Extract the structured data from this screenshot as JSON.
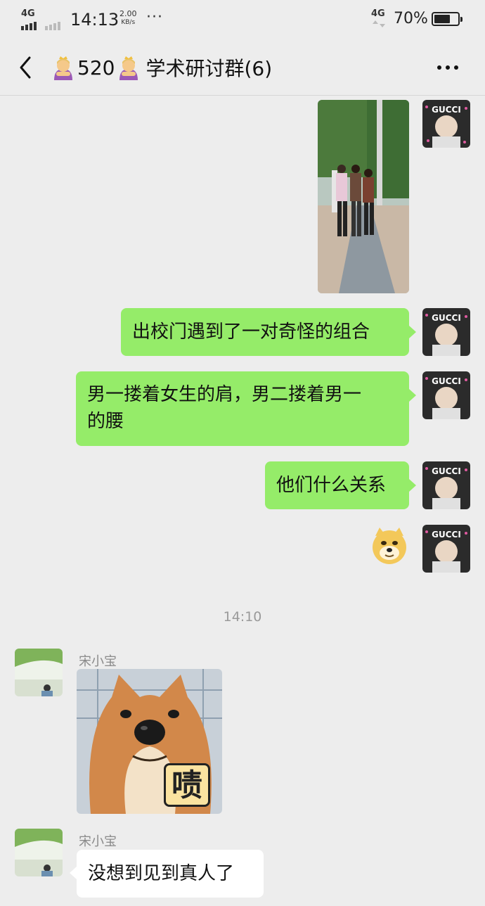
{
  "status_bar": {
    "net_left": "4G",
    "time": "14:13",
    "speed_value": "2.00",
    "speed_unit": "KB/s",
    "more_dots": "···",
    "net_right": "4G",
    "battery_percent": "70%",
    "battery_level": 0.7
  },
  "nav": {
    "back_icon": "chevron-left-icon",
    "title_number": "520",
    "title_text": "学术研讨群(6)",
    "title_emoji": "person-bowing-emoji",
    "more_icon": "more-dots-icon"
  },
  "messages": {
    "m1": {
      "type": "image",
      "icon": "street-photo"
    },
    "m2": {
      "text": "出校门遇到了一对奇怪的组合"
    },
    "m3": {
      "line1": "男一搂着女生的肩，男二搂着男一",
      "line2": "的腰"
    },
    "m4": {
      "text": "他们什么关系"
    },
    "m5": {
      "type": "sticker",
      "icon": "doge-emoji"
    },
    "timestamp": "14:10",
    "m6": {
      "sender": "宋小宝",
      "type": "sticker",
      "sticker_text": "啧",
      "icon": "shiba-dog-sticker"
    },
    "m7": {
      "sender": "宋小宝",
      "text": "没想到见到真人了"
    }
  },
  "colors": {
    "bubble_me": "#95ec69",
    "bubble_other": "#ffffff",
    "background": "#ededed"
  }
}
